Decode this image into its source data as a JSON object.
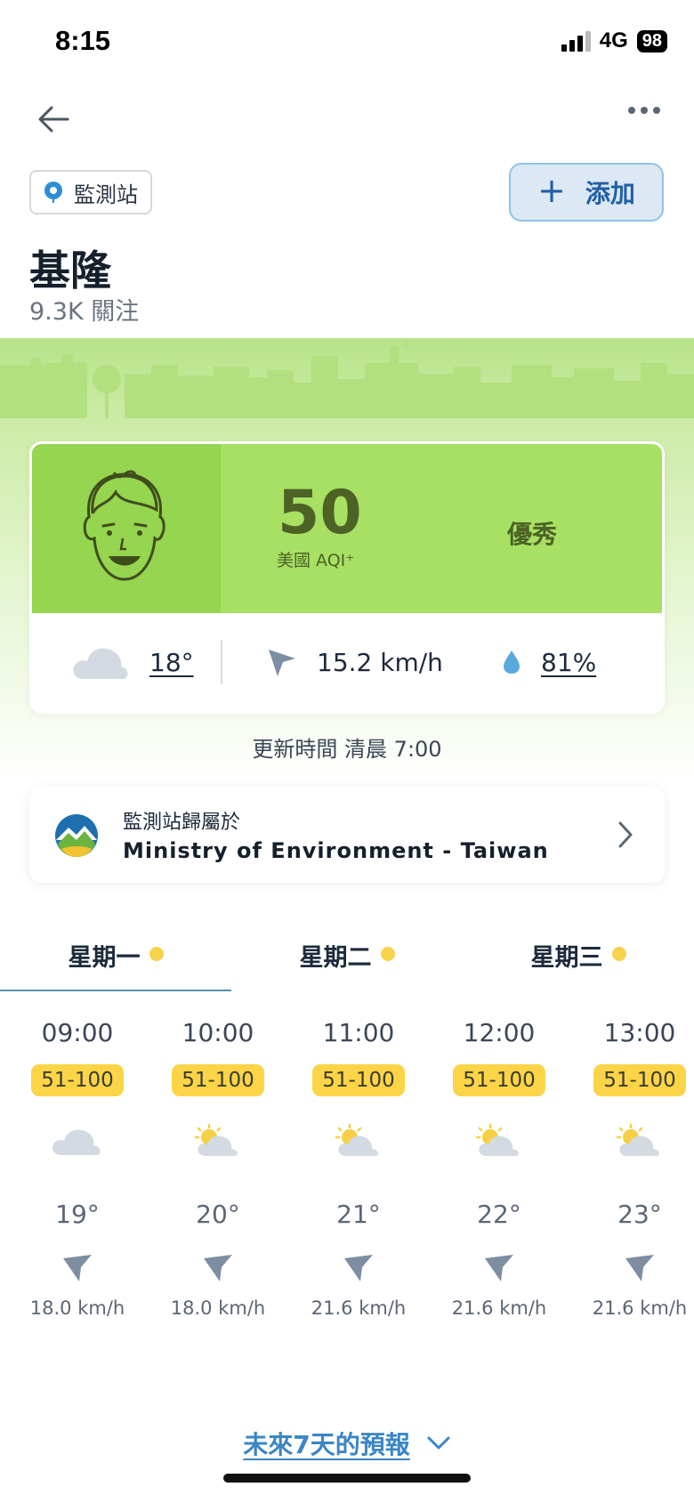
{
  "status_bar": {
    "time": "8:15",
    "network": "4G",
    "battery": "98"
  },
  "header": {
    "station_chip": "監測站",
    "add_button": "添加"
  },
  "city": {
    "name": "基隆",
    "followers": "9.3K 關注"
  },
  "aqi": {
    "value": "50",
    "unit": "美國 AQI⁺",
    "level": "優秀",
    "color": "#a7e063",
    "weather_icon": "cloud-icon",
    "temperature": "18°",
    "wind_speed": "15.2 km/h",
    "humidity": "81%"
  },
  "update_time": "更新時間 清晨 7:00",
  "ministry": {
    "subtitle": "監測站歸屬於",
    "name": "Ministry of Environment - Taiwan"
  },
  "days": [
    {
      "label": "星期一",
      "active": true
    },
    {
      "label": "星期二",
      "active": false
    },
    {
      "label": "星期三",
      "active": false
    }
  ],
  "hourly": [
    {
      "time": "09:00",
      "aqi_range": "51-100",
      "icon": "cloud-icon",
      "temp": "19°",
      "wind": "18.0 km/h"
    },
    {
      "time": "10:00",
      "aqi_range": "51-100",
      "icon": "partly-cloudy-icon",
      "temp": "20°",
      "wind": "18.0 km/h"
    },
    {
      "time": "11:00",
      "aqi_range": "51-100",
      "icon": "partly-cloudy-icon",
      "temp": "21°",
      "wind": "21.6 km/h"
    },
    {
      "time": "12:00",
      "aqi_range": "51-100",
      "icon": "partly-cloudy-icon",
      "temp": "22°",
      "wind": "21.6 km/h"
    },
    {
      "time": "13:00",
      "aqi_range": "51-100",
      "icon": "partly-cloudy-icon",
      "temp": "23°",
      "wind": "21.6 km/h"
    }
  ],
  "forecast_link": "未來7天的預報"
}
